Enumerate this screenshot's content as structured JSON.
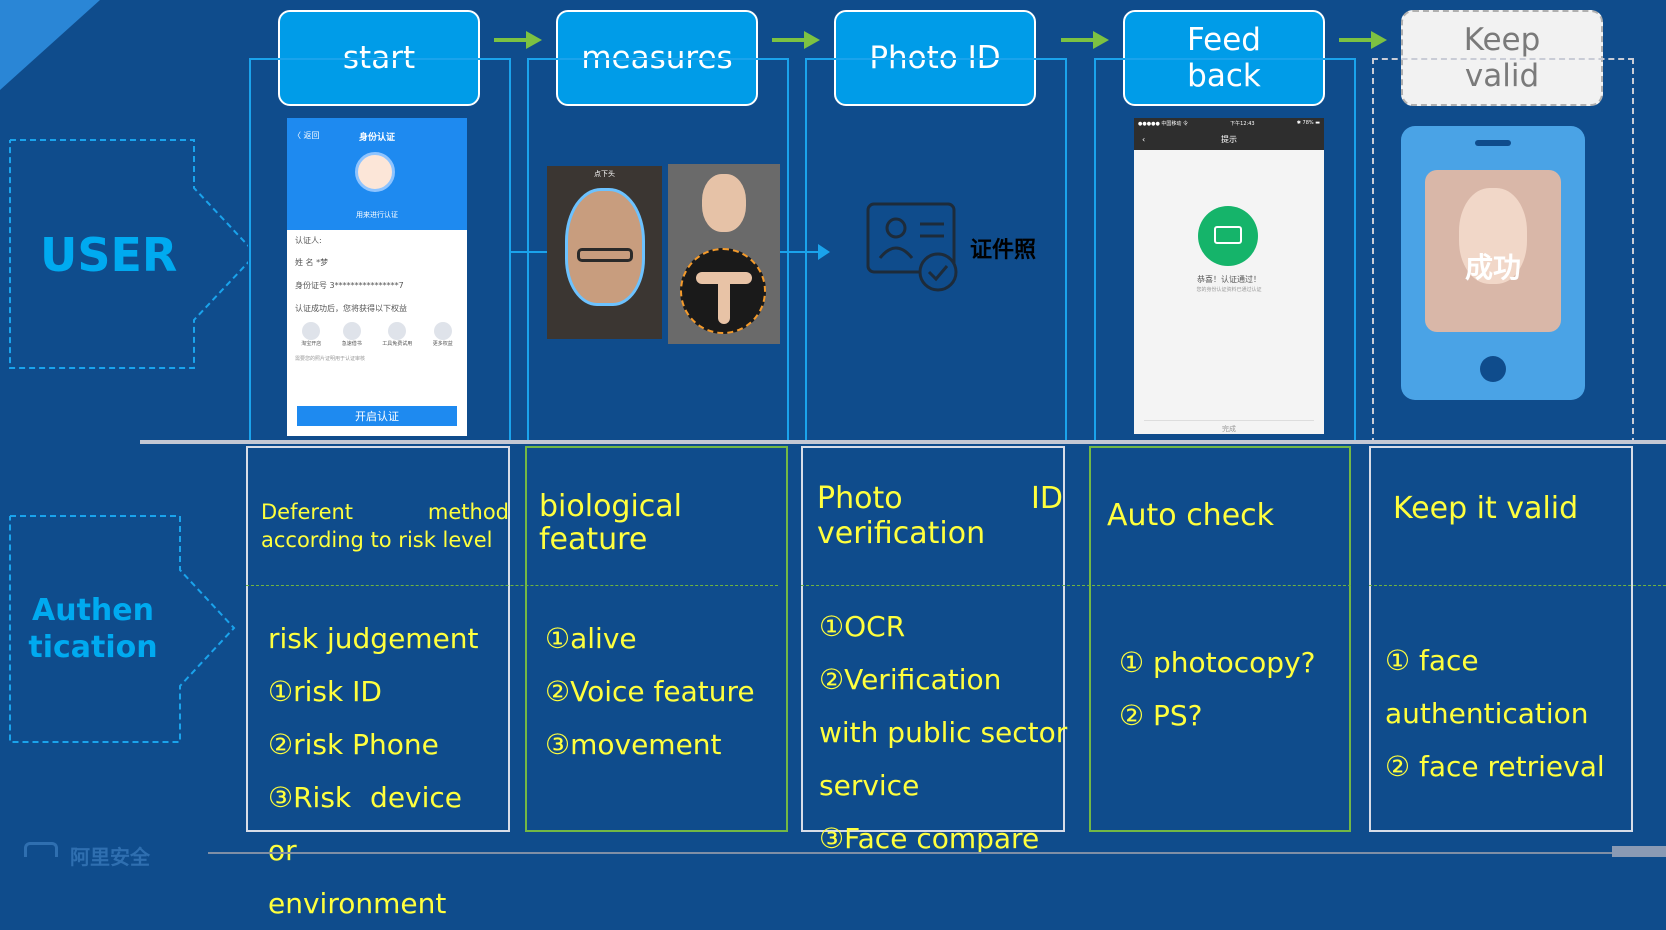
{
  "rows": {
    "user": "USER",
    "auth_line1": "Authen",
    "auth_line2": "tication"
  },
  "steps": [
    {
      "label": "start"
    },
    {
      "label": "measures"
    },
    {
      "label": "Photo ID"
    },
    {
      "label_line1": "Feed",
      "label_line2": "back"
    },
    {
      "label_line1": "Keep",
      "label_line2": "valid"
    }
  ],
  "visuals": {
    "id_card_label": "证件照",
    "success_label": "成功",
    "phone1": {
      "back": "〈 返回",
      "title": "身份认证",
      "name_caption": "用来进行认证",
      "auth_person": "认证人:",
      "name_row": "姓    名 *梦",
      "id_row": "身份证号 3****************7",
      "benefit_text": "认证成功后，您将获得以下权益",
      "icons": [
        "淘宝开店",
        "急速借书",
        "工具免费试用",
        "更多权益"
      ],
      "note": "需要您的照片证明用于认证审核",
      "button": "开启认证"
    },
    "phone2": {
      "status": "●●●●● 中国移动 令",
      "time": "下午12:43",
      "battery": "✱ 78% ▬",
      "title": "提示",
      "congrats": "恭喜！认证通过！",
      "sub": "您的身份认证资料已通过认证",
      "done": "完成"
    },
    "face_caption": "点下头"
  },
  "columns": [
    {
      "header": "Deferent method according to risk level",
      "lines": [
        "risk judgement",
        "①risk ID",
        "②risk Phone",
        "③Risk device or",
        "environment"
      ]
    },
    {
      "header": "biological feature",
      "lines": [
        "①alive",
        "②Voice feature",
        "③movement"
      ]
    },
    {
      "header": "Photo ID verification",
      "lines": [
        "①OCR",
        "②Verification",
        "with public sector",
        "service",
        "③Face compare"
      ]
    },
    {
      "header": "Auto check",
      "lines": [
        "① photocopy?",
        "② PS?"
      ]
    },
    {
      "header": "Keep it valid",
      "lines": [
        "① face",
        "authentication",
        "② face retrieval"
      ]
    }
  ],
  "footer": {
    "logo_text": "阿里安全"
  },
  "colors": {
    "background": "#0f4c8c",
    "step": "#009ce8",
    "arrow": "#7cc242",
    "text_yellow": "#ffff3d",
    "row_label": "#00aaf0"
  }
}
